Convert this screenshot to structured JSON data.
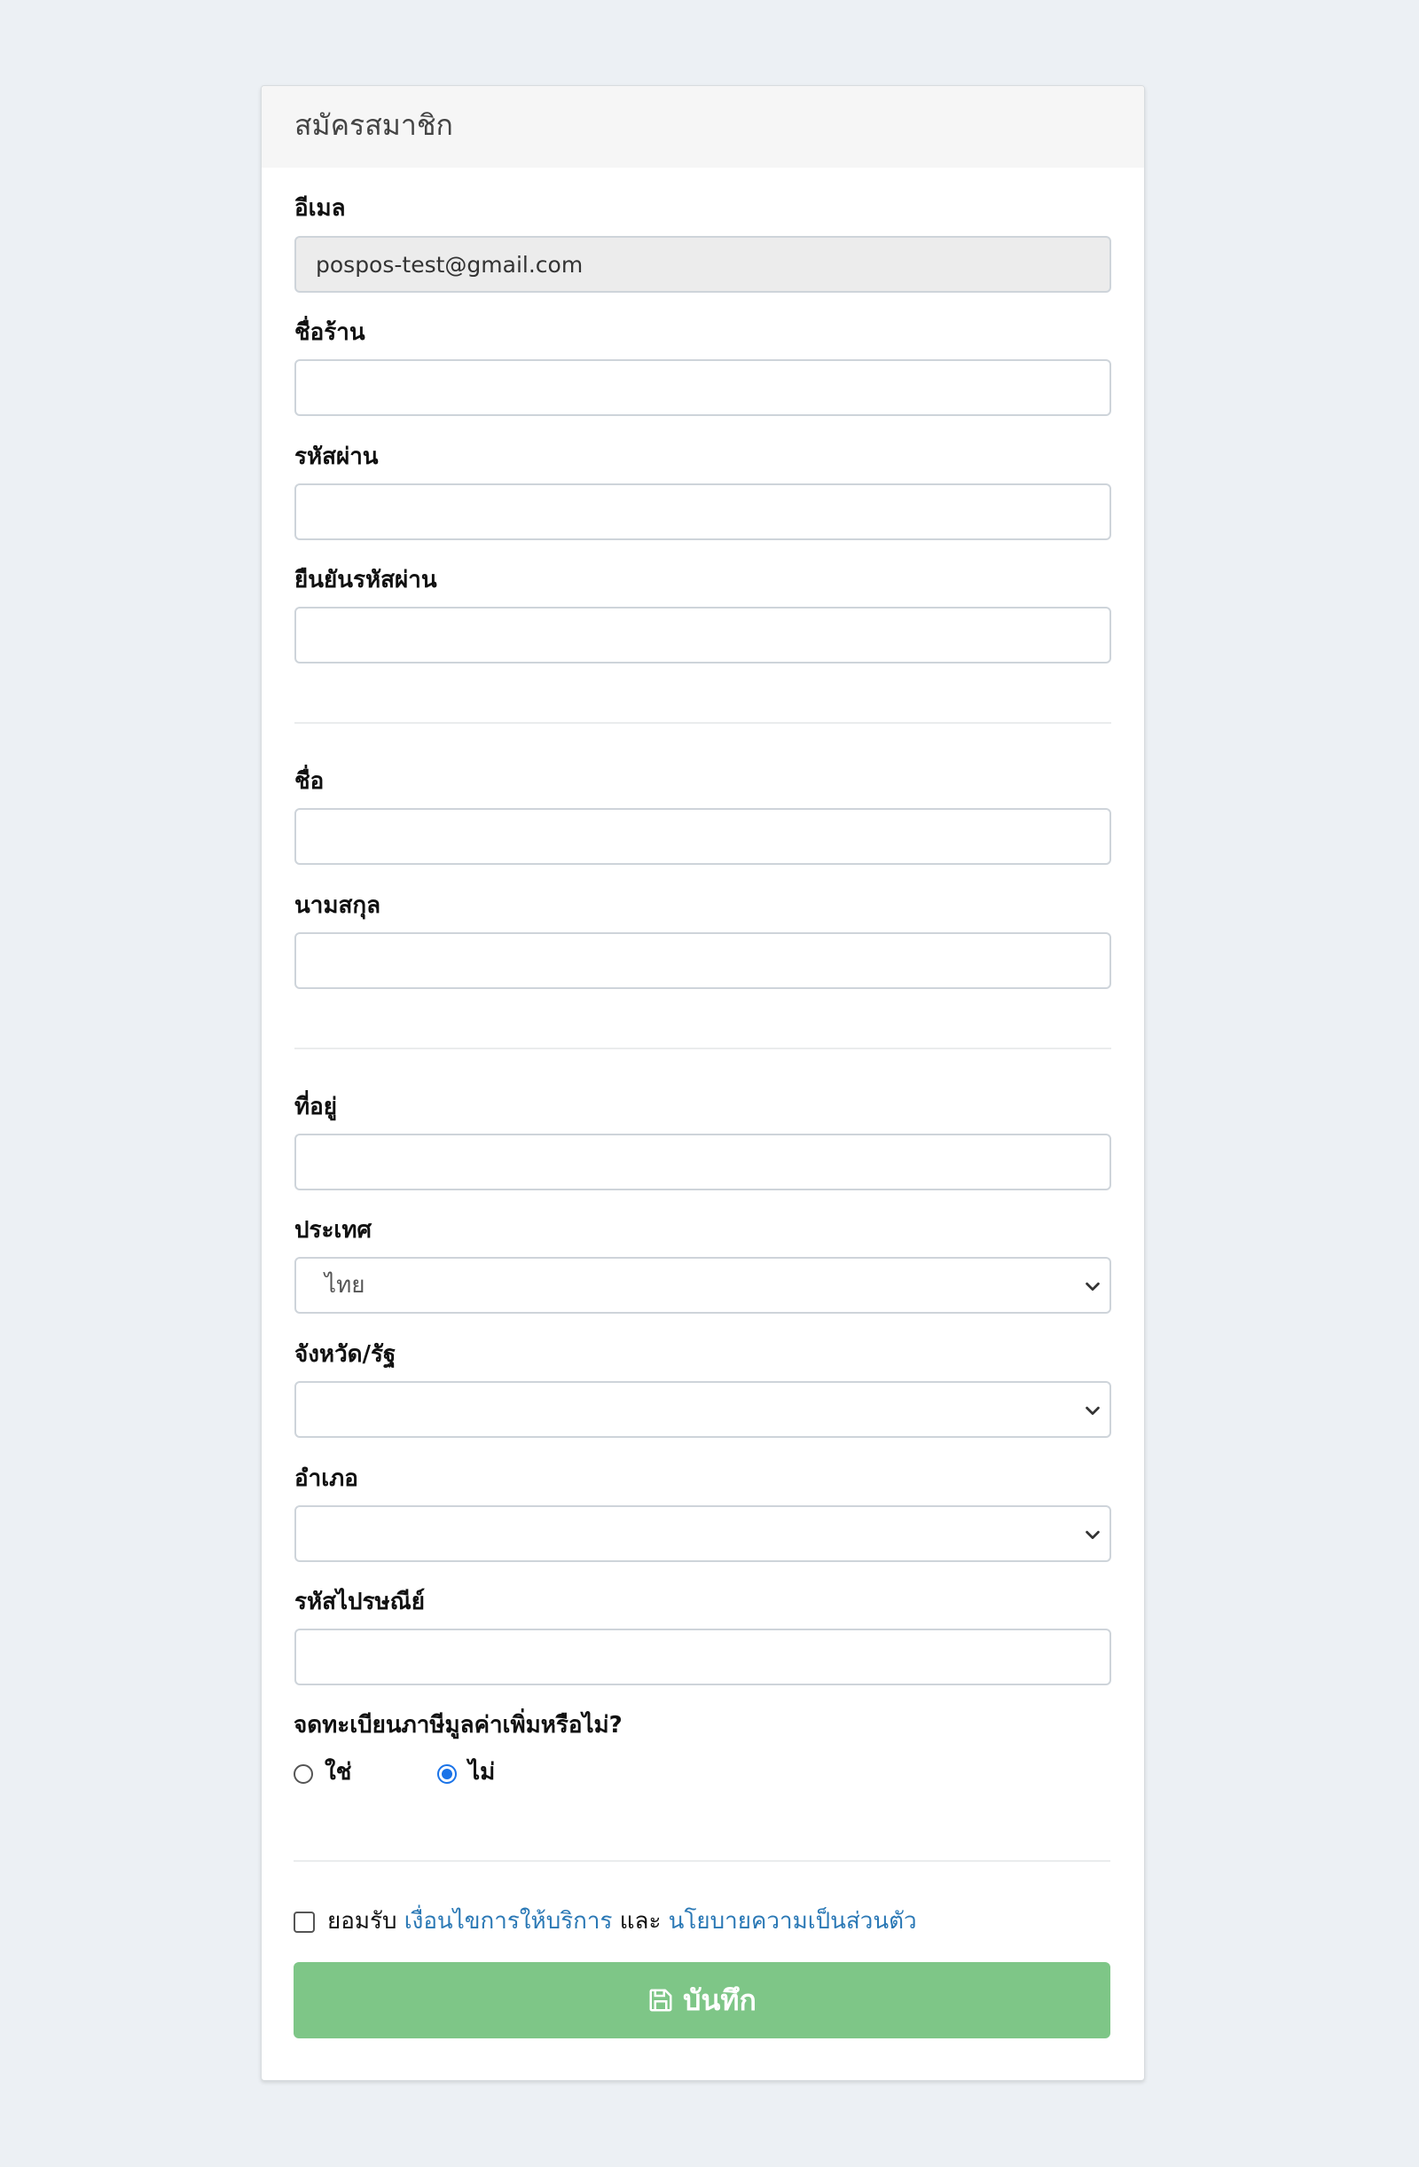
{
  "form": {
    "title": "สมัครสมาชิก",
    "email_label": "อีเมล",
    "email_value": "pospos-test@gmail.com",
    "shop_name_label": "ชื่อร้าน",
    "password_label": "รหัสผ่าน",
    "confirm_password_label": "ยืนยันรหัสผ่าน",
    "first_name_label": "ชื่อ",
    "last_name_label": "นามสกุล",
    "address_label": "ที่อยู่",
    "country_label": "ประเทศ",
    "country_value": "ไทย",
    "province_label": "จังหวัด/รัฐ",
    "province_value": "",
    "district_label": "อำเภอ",
    "district_value": "",
    "postal_code_label": "รหัสไปรษณีย์",
    "vat_question": "จดทะเบียนภาษีมูลค่าเพิ่มหรือไม่?",
    "vat_yes_label": "ใช่",
    "vat_no_label": "ไม่",
    "vat_selected": "ไม่",
    "terms_accept": "ยอมรับ",
    "terms_link": "เงื่อนไขการให้บริการ",
    "terms_and": "และ",
    "privacy_link": "นโยบายความเป็นส่วนตัว",
    "save_label": "บันทึก"
  },
  "colors": {
    "background": "#ecf0f4",
    "save_button": "#7ec687",
    "link": "#2a78b5",
    "radio_checked": "#1a73e8"
  },
  "icons": {
    "save": "floppy-disk-icon",
    "select_arrow": "chevron-down-icon"
  }
}
